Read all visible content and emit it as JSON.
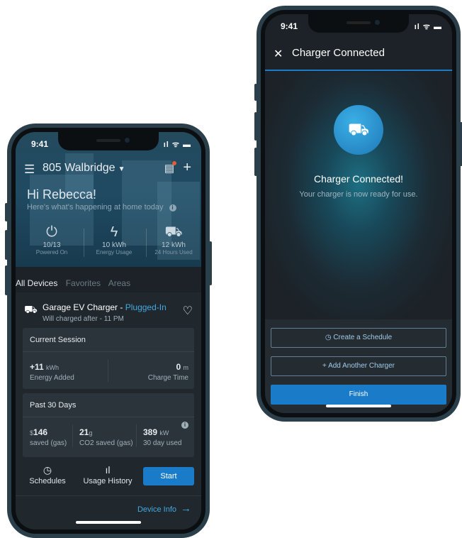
{
  "left_phone": {
    "status_time": "9:41",
    "status_icons": "ıl ᯤ ▬",
    "home_name": "805 Walbridge",
    "greeting": "Hi Rebecca!",
    "subtitle": "Here's what's happening at home today",
    "stats": [
      {
        "icon": "power-icon",
        "value": "10/13",
        "label": "Powered On"
      },
      {
        "icon": "bolt-icon",
        "value": "10 kWh",
        "label": "Energy Usage"
      },
      {
        "icon": "car-icon",
        "value": "12 kWh",
        "label": "24 Hours Used"
      }
    ],
    "tabs": [
      "All Devices",
      "Favorites",
      "Areas"
    ],
    "charger": {
      "name": "Garage EV Charger - ",
      "status": "Plugged-In",
      "note": "Will charged after - 11 PM"
    },
    "current_session": {
      "title": "Current Session",
      "energy_value": "+11",
      "energy_unit": "kWh",
      "energy_label": "Energy Added",
      "time_value": "0",
      "time_unit": "m",
      "time_label": "Charge Time"
    },
    "past_30": {
      "title": "Past 30 Days",
      "saved_prefix": "$",
      "saved_value": "146",
      "saved_label": "saved (gas)",
      "co2_value": "21",
      "co2_unit": "g",
      "co2_label": "CO2 saved (gas)",
      "used_value": "389",
      "used_unit": "kW",
      "used_label": "30 day used"
    },
    "actions": {
      "schedules": "Schedules",
      "usage_history": "Usage History",
      "start": "Start"
    },
    "device_info": "Device Info"
  },
  "right_phone": {
    "status_time": "9:41",
    "status_icons": "ıl ᯤ ▬",
    "title": "Charger Connected",
    "heading": "Charger Connected!",
    "message": "Your charger is now ready for use.",
    "create_schedule": "Create a Schedule",
    "add_charger": "Add Another Charger",
    "finish": "Finish"
  },
  "colors": {
    "accent": "#1a7cc9",
    "link": "#43a8e0",
    "frame": "#2b3f4b",
    "screen_bg": "#1c2227"
  }
}
